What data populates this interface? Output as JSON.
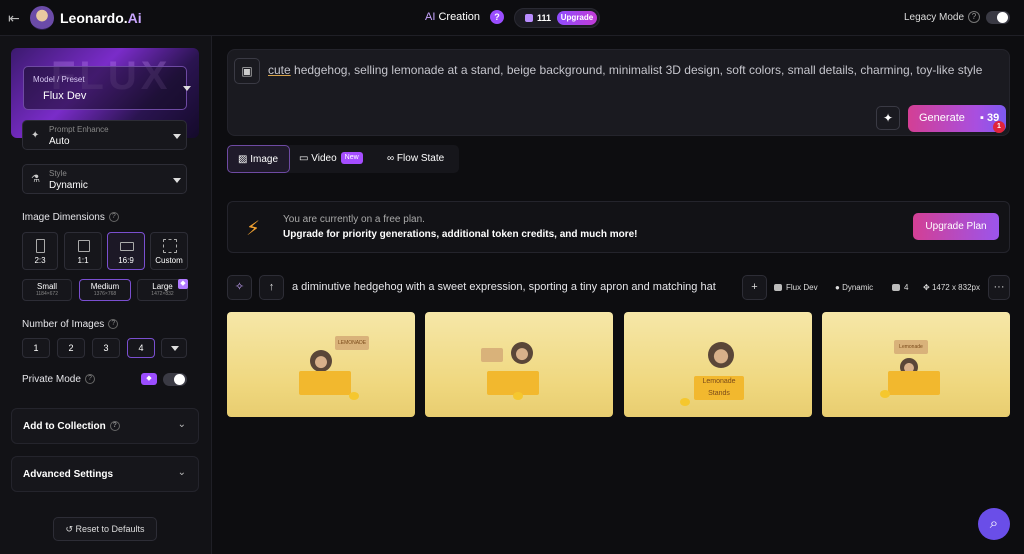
{
  "header": {
    "brand_name": "Leonardo.",
    "brand_ai": "Ai",
    "ai_prefix": "AI",
    "ai_creation": " Creation",
    "help": "?",
    "tokens": "111",
    "upgrade": "Upgrade",
    "legacy_mode": "Legacy Mode",
    "legacy_help": "?"
  },
  "sidebar": {
    "model_label": "Model / Preset",
    "model_value": "Flux Dev",
    "model_bg_text": "FLUX",
    "prompt_enhance_label": "Prompt Enhance",
    "prompt_enhance_value": "Auto",
    "style_label": "Style",
    "style_value": "Dynamic",
    "image_dimensions": "Image Dimensions",
    "dims": [
      "2:3",
      "1:1",
      "16:9",
      "Custom"
    ],
    "sizes": [
      {
        "name": "Small",
        "px": "1184×672"
      },
      {
        "name": "Medium",
        "px": "1376×768"
      },
      {
        "name": "Large",
        "px": "1472×832"
      }
    ],
    "number_of_images": "Number of Images",
    "numbers": [
      "1",
      "2",
      "3",
      "4"
    ],
    "private_mode": "Private Mode",
    "add_to_collection": "Add to Collection",
    "advanced_settings": "Advanced Settings",
    "reset": "Reset to Defaults"
  },
  "prompt": {
    "first_word": "cute",
    "rest": " hedgehog, selling lemonade at a stand, beige background, minimalist 3D design, soft colors, small details, charming, toy-like style",
    "generate": "Generate",
    "cost": "39",
    "notification": "1"
  },
  "tabs": {
    "image": "Image",
    "video": "Video",
    "new_badge": "New",
    "flow_state": "Flow State"
  },
  "banner": {
    "line1": "You are currently on a free plan.",
    "line2": "Upgrade for priority generations, additional token credits, and much more!",
    "button": "Upgrade Plan"
  },
  "generation": {
    "prompt": "a diminutive hedgehog with a sweet expression, sporting a tiny apron and matching hat",
    "model": "Flux Dev",
    "style": "Dynamic",
    "count": "4",
    "size": "1472 x 832px",
    "more": "···",
    "signs": [
      "LEMONADE",
      "",
      "Lemonade Stands",
      "Lemonade"
    ]
  },
  "colors": {
    "accent": "#9a4dff",
    "generate_start": "#d33f94",
    "bolt": "#f0a030"
  }
}
